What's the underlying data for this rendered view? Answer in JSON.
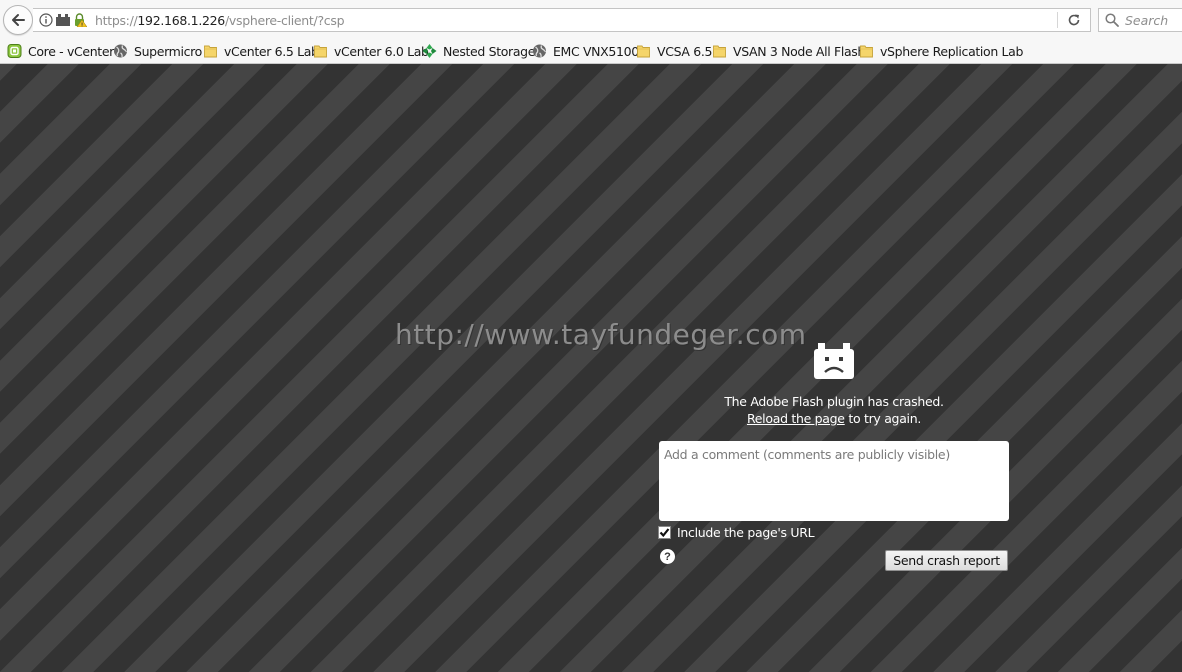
{
  "navbar": {
    "url_prefix": "https://",
    "url_host": "192.168.1.226",
    "url_path": "/vsphere-client/?csp",
    "search_placeholder": "Search"
  },
  "bookmarks": [
    {
      "label": "Core - vCenter",
      "icon": "vmware-icon"
    },
    {
      "label": "Supermicro",
      "icon": "globe-icon"
    },
    {
      "label": "vCenter 6.5 Lab",
      "icon": "folder-icon"
    },
    {
      "label": "vCenter 6.0 Lab",
      "icon": "folder-icon"
    },
    {
      "label": "Nested Storage",
      "icon": "green-logo-icon"
    },
    {
      "label": "EMC VNX5100",
      "icon": "globe-icon"
    },
    {
      "label": "VCSA 6.5",
      "icon": "folder-icon"
    },
    {
      "label": "VSAN 3 Node All Flash",
      "icon": "folder-icon"
    },
    {
      "label": "vSphere Replication Lab",
      "icon": "folder-icon"
    }
  ],
  "content": {
    "watermark": "http://www.tayfundeger.com",
    "crash_message": "The Adobe Flash plugin has crashed.",
    "reload_link": "Reload the page",
    "reload_suffix": " to try again.",
    "comment_placeholder": "Add a comment (comments are publicly visible)",
    "include_url_label": "Include the page's URL",
    "include_url_checked": true,
    "help_glyph": "?",
    "send_button": "Send crash report"
  },
  "colors": {
    "stripe_dark": "#333333",
    "stripe_light": "#454545",
    "toolbar_bg": "#f7f7f7",
    "folder_yellow": "#f5d56a",
    "vmware_green": "#78b828"
  }
}
